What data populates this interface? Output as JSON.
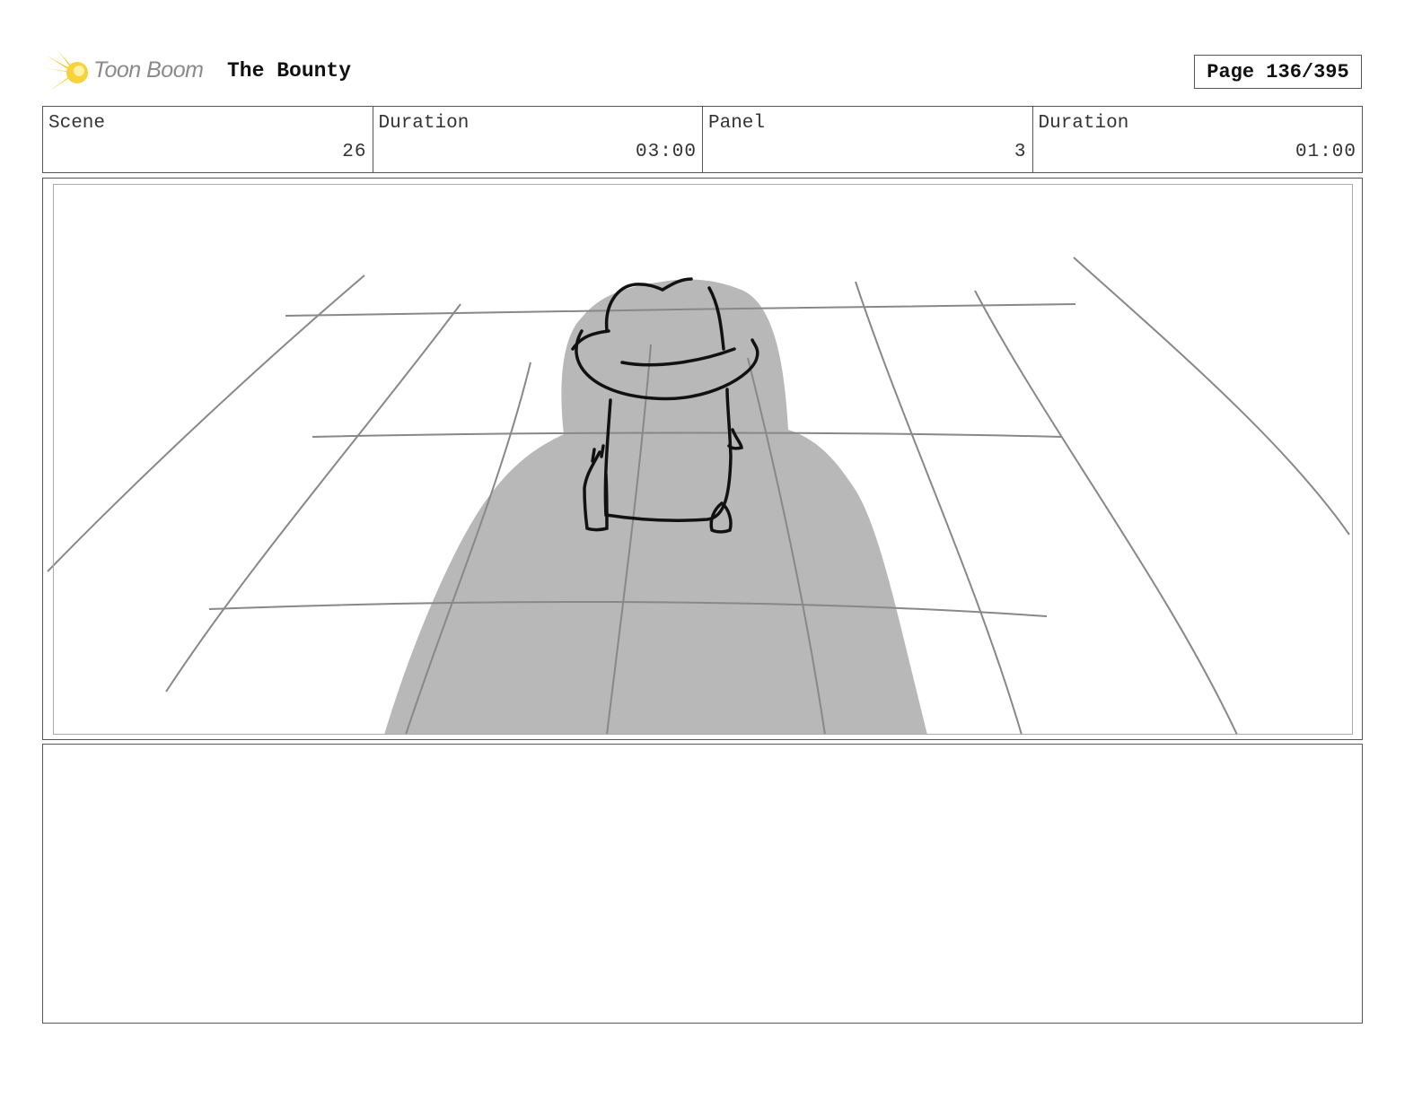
{
  "header": {
    "logo_text": "Toon Boom",
    "project_title": "The Bounty",
    "page_label": "Page 136/395"
  },
  "info": {
    "scene_label": "Scene",
    "scene_value": "26",
    "scene_duration_label": "Duration",
    "scene_duration_value": "03:00",
    "panel_label": "Panel",
    "panel_value": "3",
    "panel_duration_label": "Duration",
    "panel_duration_value": "01:00"
  },
  "panel": {
    "image_icon": "storyboard-sketch-icon",
    "shadow_color": "#b8b8b8",
    "line_color": "#888888",
    "ink_color": "#111111"
  },
  "notes": {
    "text": ""
  },
  "colors": {
    "logo_star": "#f5c518",
    "logo_text": "#8a8a8a",
    "border": "#555555"
  }
}
